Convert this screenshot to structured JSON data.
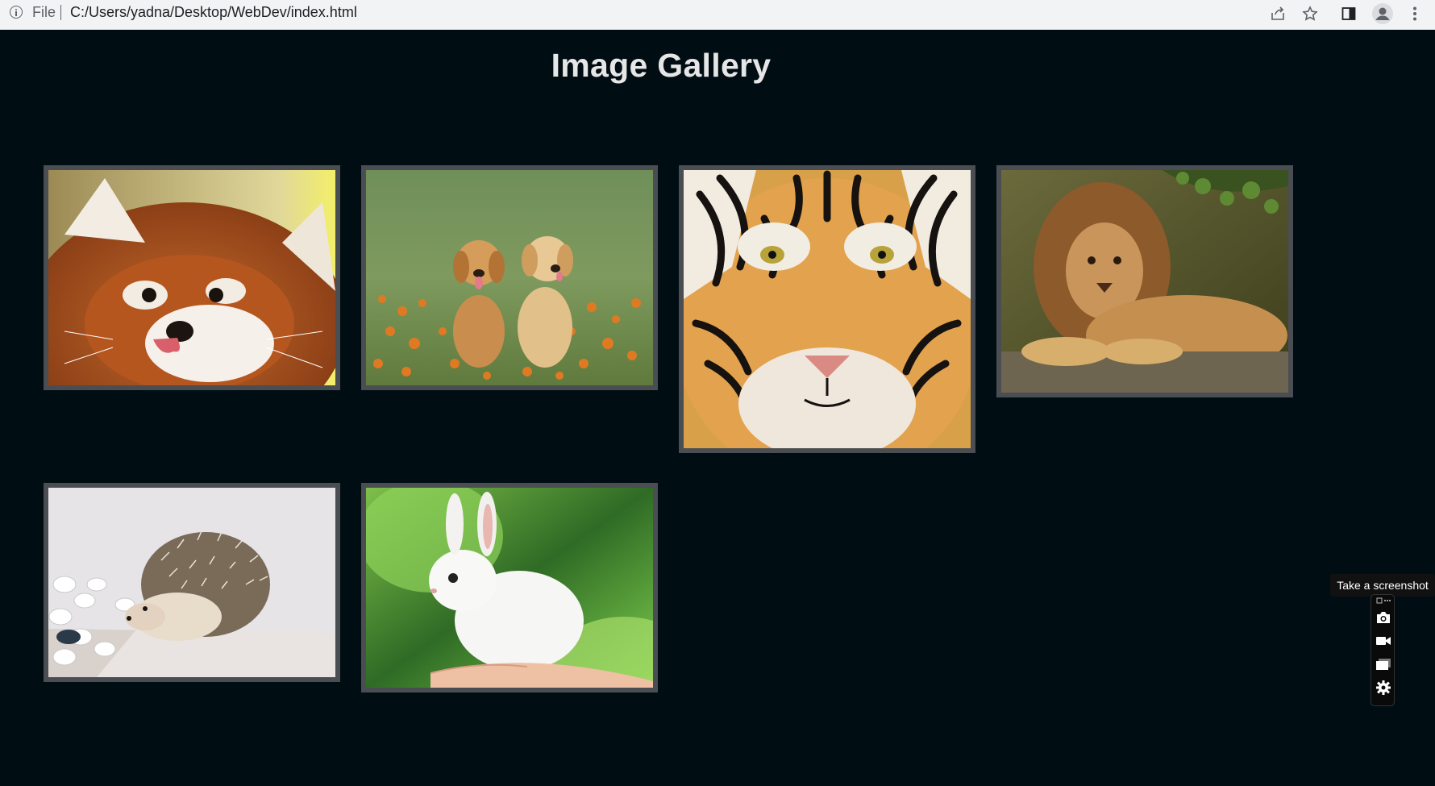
{
  "browser": {
    "file_label": "File",
    "url": "C:/Users/yadna/Desktop/WebDev/index.html",
    "icons": [
      "info-icon",
      "share-icon",
      "star-icon",
      "side-panel-icon",
      "profile-icon",
      "menu-icon"
    ]
  },
  "page": {
    "title": "Image Gallery",
    "background": "#000e14",
    "frame_color": "#4a4e52"
  },
  "gallery": {
    "images": [
      {
        "subject": "red panda"
      },
      {
        "subject": "golden retriever puppies"
      },
      {
        "subject": "tiger"
      },
      {
        "subject": "lion"
      },
      {
        "subject": "hedgehog"
      },
      {
        "subject": "white rabbit"
      }
    ]
  },
  "screenshot_tool": {
    "tooltip": "Take a screenshot",
    "buttons": [
      "camera-icon",
      "video-icon",
      "window-icon",
      "gear-icon"
    ]
  }
}
